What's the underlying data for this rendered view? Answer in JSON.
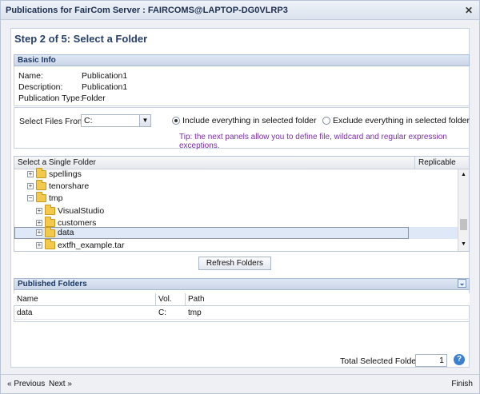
{
  "window": {
    "title": "Publications for FairCom Server : FAIRCOMS@LAPTOP-DG0VLRP3",
    "close_icon": "✕"
  },
  "step_title": "Step 2 of 5: Select a Folder",
  "basic_info": {
    "header": "Basic Info",
    "rows": [
      {
        "label": "Name:",
        "value": "Publication1"
      },
      {
        "label": "Description:",
        "value": "Publication1"
      },
      {
        "label": "Publication Type:",
        "value": "Folder"
      }
    ]
  },
  "select_files": {
    "label": "Select Files From:",
    "value": "C:",
    "include_label": "Include everything in selected folder",
    "exclude_label": "Exclude everything in selected folder",
    "selected": "include",
    "tip": "Tip: the next panels allow you to define file, wildcard and regular expression exceptions.",
    "tip_color": "#7a2fa6"
  },
  "folder_tree": {
    "header_left": "Select a Single Folder",
    "header_right": "Replicable",
    "rows": [
      {
        "name": "spellings",
        "level": 1,
        "selected": false
      },
      {
        "name": "tenorshare",
        "level": 1,
        "selected": false
      },
      {
        "name": "tmp",
        "level": 1,
        "selected": false
      },
      {
        "name": "VisualStudio",
        "level": 2,
        "selected": false
      },
      {
        "name": "customers",
        "level": 2,
        "selected": false
      },
      {
        "name": "data",
        "level": 2,
        "selected": true
      },
      {
        "name": "extfh_example.tar",
        "level": 2,
        "selected": false
      }
    ]
  },
  "refresh_button": "Refresh Folders",
  "published": {
    "header": "Published Folders",
    "collapse_icon": "⌄",
    "columns": [
      "Name",
      "Vol.",
      "Path"
    ],
    "rows": [
      {
        "name": "data",
        "vol": "C:",
        "path": "tmp"
      }
    ]
  },
  "total": {
    "label": "Total Selected Folders:",
    "value": "1",
    "help_icon": "?"
  },
  "footer": {
    "previous": "« Previous",
    "next": "Next »",
    "finish": "Finish"
  }
}
